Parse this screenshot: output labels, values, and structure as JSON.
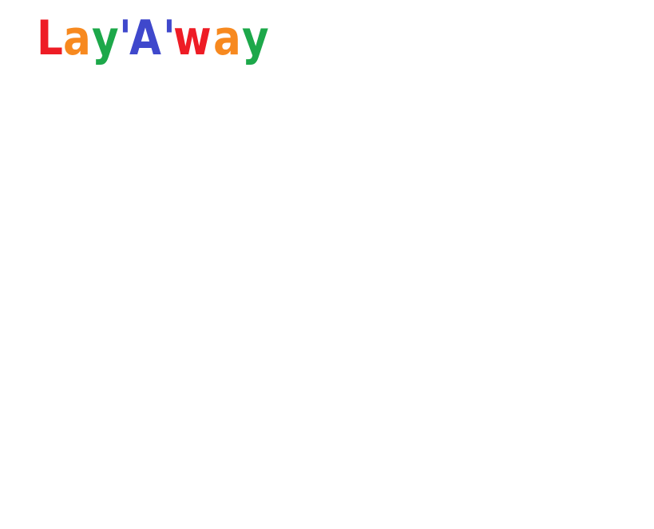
{
  "brand": {
    "letters": [
      {
        "char": "L",
        "color": "#ee1c25"
      },
      {
        "char": "a",
        "color": "#f7891f"
      },
      {
        "char": "y",
        "color": "#1da84a"
      },
      {
        "char": "'",
        "color": "#3f48cc"
      },
      {
        "char": "A",
        "color": "#3f48cc"
      },
      {
        "char": "'",
        "color": "#3f48cc"
      },
      {
        "char": "w",
        "color": "#ee1c25"
      },
      {
        "char": "a",
        "color": "#f7891f"
      },
      {
        "char": "y",
        "color": "#1da84a"
      }
    ]
  }
}
